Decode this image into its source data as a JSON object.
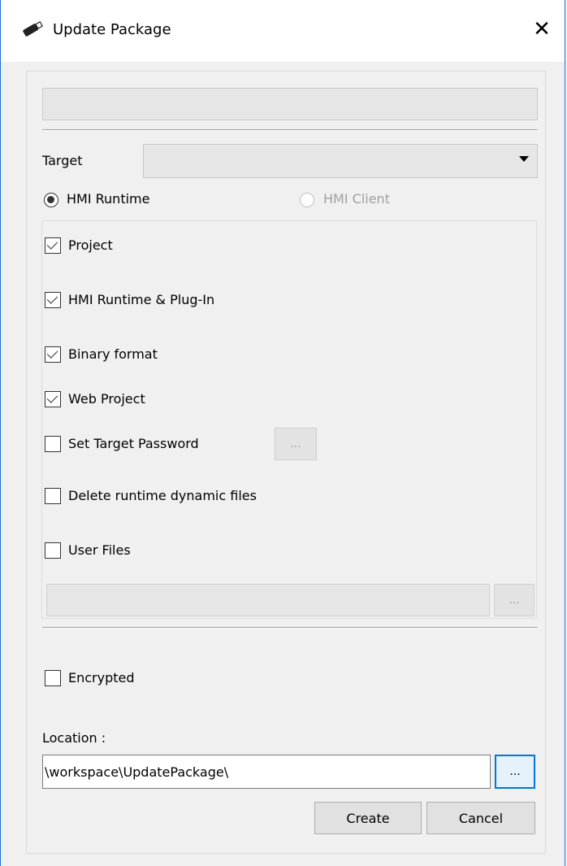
{
  "window": {
    "title": "Update Package",
    "close_glyph": "✕",
    "icon": "usb-stick-icon"
  },
  "description": {
    "value": ""
  },
  "target": {
    "label": "Target",
    "selected": ""
  },
  "mode": {
    "hmi_runtime": {
      "label": "HMI Runtime",
      "checked": true
    },
    "hmi_client": {
      "label": "HMI Client",
      "checked": false,
      "disabled": true
    }
  },
  "options": {
    "project": {
      "label": "Project",
      "checked": true
    },
    "runtime_plugin": {
      "label": "HMI Runtime & Plug-In",
      "checked": true
    },
    "binary_format": {
      "label": "Binary format",
      "checked": true
    },
    "web_project": {
      "label": "Web Project",
      "checked": true
    },
    "set_target_password": {
      "label": "Set Target Password",
      "checked": false,
      "button_label": "..."
    },
    "delete_dynamic": {
      "label": "Delete runtime dynamic files",
      "checked": false
    },
    "user_files": {
      "label": "User Files",
      "checked": false,
      "path": "",
      "button_label": "..."
    }
  },
  "encrypted": {
    "label": "Encrypted",
    "checked": false
  },
  "location": {
    "label": "Location :",
    "value": "\\workspace\\UpdatePackage\\",
    "browse_label": "..."
  },
  "buttons": {
    "create": "Create",
    "cancel": "Cancel"
  },
  "colors": {
    "accent": "#0078d7",
    "window_bg": "#f0f0f0"
  }
}
